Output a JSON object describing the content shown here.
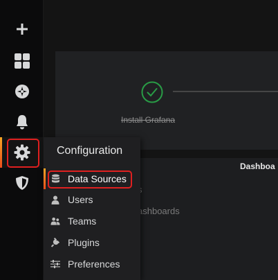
{
  "sidebar": {
    "items": [
      {
        "name": "create",
        "icon": "plus-icon"
      },
      {
        "name": "dashboards",
        "icon": "grid-icon"
      },
      {
        "name": "explore",
        "icon": "compass-icon"
      },
      {
        "name": "alerting",
        "icon": "bell-icon"
      },
      {
        "name": "configuration",
        "icon": "gear-icon",
        "active": true
      },
      {
        "name": "server-admin",
        "icon": "shield-icon"
      }
    ]
  },
  "steps": {
    "install_label": "Install Grafana",
    "accent": "#299c46"
  },
  "dashboards_panel": {
    "header": "Dashboa",
    "item_1": "s",
    "item_2": "ashboards"
  },
  "config_menu": {
    "title": "Configuration",
    "items": [
      {
        "label": "Data Sources",
        "icon": "database-icon",
        "active": true
      },
      {
        "label": "Users",
        "icon": "user-icon"
      },
      {
        "label": "Teams",
        "icon": "team-icon"
      },
      {
        "label": "Plugins",
        "icon": "plug-icon"
      },
      {
        "label": "Preferences",
        "icon": "sliders-icon"
      }
    ]
  },
  "colors": {
    "highlight_box": "#e02020",
    "active_gradient_start": "#f6a623",
    "active_gradient_end": "#ec4c1c"
  }
}
